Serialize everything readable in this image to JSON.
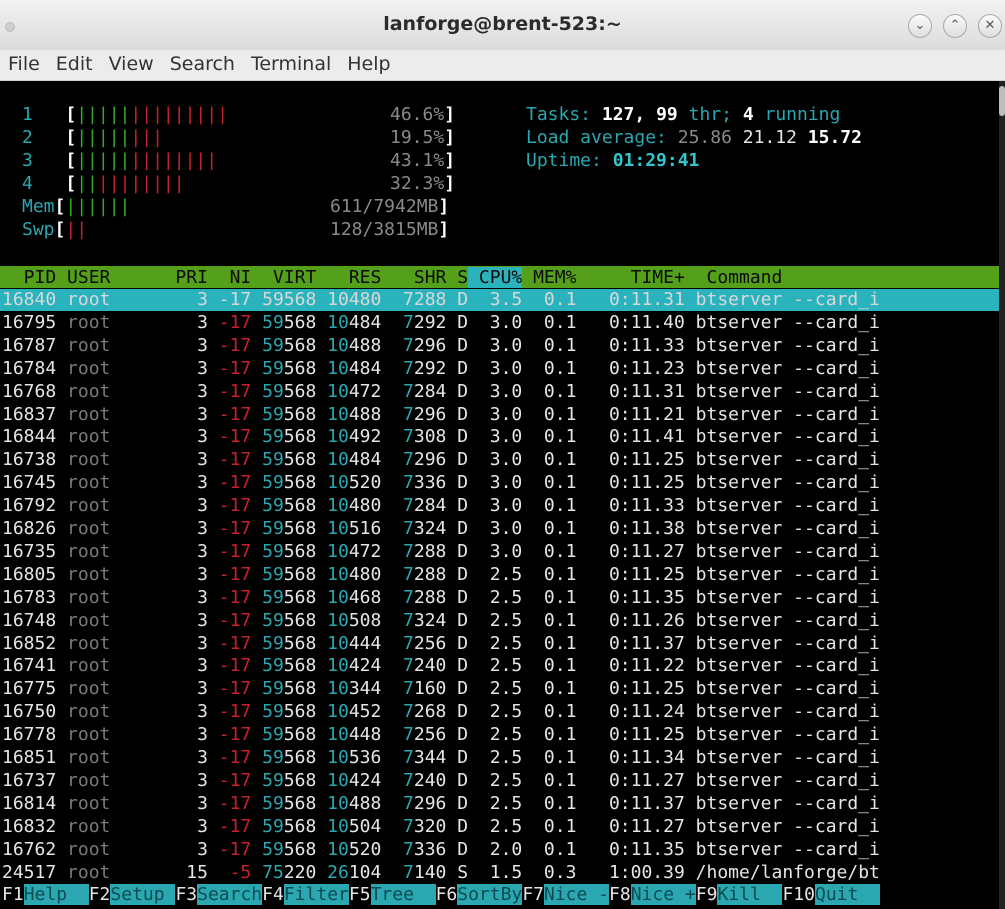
{
  "window": {
    "title": "lanforge@brent-523:~"
  },
  "menubar": [
    "File",
    "Edit",
    "View",
    "Search",
    "Terminal",
    "Help"
  ],
  "meters": {
    "cpu": [
      {
        "id": "1",
        "bar_green": "|||||",
        "bar_red": "|||||||||",
        "percent": "46.6%"
      },
      {
        "id": "2",
        "bar_green": "|||||",
        "bar_red": "|||",
        "percent": "19.5%"
      },
      {
        "id": "3",
        "bar_green": "|||||",
        "bar_red": "||||||||",
        "percent": "43.1%"
      },
      {
        "id": "4",
        "bar_green": "||",
        "bar_red": "||||||||",
        "percent": "32.3%"
      }
    ],
    "mem": {
      "label": "Mem",
      "bar_green": "||||||",
      "value": "611/7942MB"
    },
    "swp": {
      "label": "Swp",
      "bar_red": "||",
      "value": "128/3815MB"
    }
  },
  "summary": {
    "tasks_label": "Tasks:",
    "tasks": "127,",
    "threads": "99",
    "thr_label": "thr;",
    "running": "4",
    "running_label": "running",
    "load_label": "Load average:",
    "load1": "25.86",
    "load5": "21.12",
    "load15": "15.72",
    "uptime_label": "Uptime:",
    "uptime": "01:29:41"
  },
  "columns": [
    "PID",
    "USER",
    "PRI",
    "NI",
    "VIRT",
    "RES",
    "SHR",
    "S",
    "CPU%",
    "MEM%",
    "TIME+",
    "Command"
  ],
  "processes": [
    {
      "pid": "16840",
      "user": "root",
      "pri": "3",
      "ni": "-17",
      "virt": "59568",
      "res": "10480",
      "shr": "7288",
      "s": "D",
      "cpu": "3.5",
      "mem": "0.1",
      "time": "0:11.31",
      "cmd": "btserver --card_i"
    },
    {
      "pid": "16795",
      "user": "root",
      "pri": "3",
      "ni": "-17",
      "virt": "59568",
      "res": "10484",
      "shr": "7292",
      "s": "D",
      "cpu": "3.0",
      "mem": "0.1",
      "time": "0:11.40",
      "cmd": "btserver --card_i"
    },
    {
      "pid": "16787",
      "user": "root",
      "pri": "3",
      "ni": "-17",
      "virt": "59568",
      "res": "10488",
      "shr": "7296",
      "s": "D",
      "cpu": "3.0",
      "mem": "0.1",
      "time": "0:11.33",
      "cmd": "btserver --card_i"
    },
    {
      "pid": "16784",
      "user": "root",
      "pri": "3",
      "ni": "-17",
      "virt": "59568",
      "res": "10484",
      "shr": "7292",
      "s": "D",
      "cpu": "3.0",
      "mem": "0.1",
      "time": "0:11.23",
      "cmd": "btserver --card_i"
    },
    {
      "pid": "16768",
      "user": "root",
      "pri": "3",
      "ni": "-17",
      "virt": "59568",
      "res": "10472",
      "shr": "7284",
      "s": "D",
      "cpu": "3.0",
      "mem": "0.1",
      "time": "0:11.31",
      "cmd": "btserver --card_i"
    },
    {
      "pid": "16837",
      "user": "root",
      "pri": "3",
      "ni": "-17",
      "virt": "59568",
      "res": "10488",
      "shr": "7296",
      "s": "D",
      "cpu": "3.0",
      "mem": "0.1",
      "time": "0:11.21",
      "cmd": "btserver --card_i"
    },
    {
      "pid": "16844",
      "user": "root",
      "pri": "3",
      "ni": "-17",
      "virt": "59568",
      "res": "10492",
      "shr": "7308",
      "s": "D",
      "cpu": "3.0",
      "mem": "0.1",
      "time": "0:11.41",
      "cmd": "btserver --card_i"
    },
    {
      "pid": "16738",
      "user": "root",
      "pri": "3",
      "ni": "-17",
      "virt": "59568",
      "res": "10484",
      "shr": "7296",
      "s": "D",
      "cpu": "3.0",
      "mem": "0.1",
      "time": "0:11.25",
      "cmd": "btserver --card_i"
    },
    {
      "pid": "16745",
      "user": "root",
      "pri": "3",
      "ni": "-17",
      "virt": "59568",
      "res": "10520",
      "shr": "7336",
      "s": "D",
      "cpu": "3.0",
      "mem": "0.1",
      "time": "0:11.25",
      "cmd": "btserver --card_i"
    },
    {
      "pid": "16792",
      "user": "root",
      "pri": "3",
      "ni": "-17",
      "virt": "59568",
      "res": "10480",
      "shr": "7284",
      "s": "D",
      "cpu": "3.0",
      "mem": "0.1",
      "time": "0:11.33",
      "cmd": "btserver --card_i"
    },
    {
      "pid": "16826",
      "user": "root",
      "pri": "3",
      "ni": "-17",
      "virt": "59568",
      "res": "10516",
      "shr": "7324",
      "s": "D",
      "cpu": "3.0",
      "mem": "0.1",
      "time": "0:11.38",
      "cmd": "btserver --card_i"
    },
    {
      "pid": "16735",
      "user": "root",
      "pri": "3",
      "ni": "-17",
      "virt": "59568",
      "res": "10472",
      "shr": "7288",
      "s": "D",
      "cpu": "3.0",
      "mem": "0.1",
      "time": "0:11.27",
      "cmd": "btserver --card_i"
    },
    {
      "pid": "16805",
      "user": "root",
      "pri": "3",
      "ni": "-17",
      "virt": "59568",
      "res": "10480",
      "shr": "7288",
      "s": "D",
      "cpu": "2.5",
      "mem": "0.1",
      "time": "0:11.25",
      "cmd": "btserver --card_i"
    },
    {
      "pid": "16783",
      "user": "root",
      "pri": "3",
      "ni": "-17",
      "virt": "59568",
      "res": "10468",
      "shr": "7288",
      "s": "D",
      "cpu": "2.5",
      "mem": "0.1",
      "time": "0:11.35",
      "cmd": "btserver --card_i"
    },
    {
      "pid": "16748",
      "user": "root",
      "pri": "3",
      "ni": "-17",
      "virt": "59568",
      "res": "10508",
      "shr": "7324",
      "s": "D",
      "cpu": "2.5",
      "mem": "0.1",
      "time": "0:11.26",
      "cmd": "btserver --card_i"
    },
    {
      "pid": "16852",
      "user": "root",
      "pri": "3",
      "ni": "-17",
      "virt": "59568",
      "res": "10444",
      "shr": "7256",
      "s": "D",
      "cpu": "2.5",
      "mem": "0.1",
      "time": "0:11.37",
      "cmd": "btserver --card_i"
    },
    {
      "pid": "16741",
      "user": "root",
      "pri": "3",
      "ni": "-17",
      "virt": "59568",
      "res": "10424",
      "shr": "7240",
      "s": "D",
      "cpu": "2.5",
      "mem": "0.1",
      "time": "0:11.22",
      "cmd": "btserver --card_i"
    },
    {
      "pid": "16775",
      "user": "root",
      "pri": "3",
      "ni": "-17",
      "virt": "59568",
      "res": "10344",
      "shr": "7160",
      "s": "D",
      "cpu": "2.5",
      "mem": "0.1",
      "time": "0:11.25",
      "cmd": "btserver --card_i"
    },
    {
      "pid": "16750",
      "user": "root",
      "pri": "3",
      "ni": "-17",
      "virt": "59568",
      "res": "10452",
      "shr": "7268",
      "s": "D",
      "cpu": "2.5",
      "mem": "0.1",
      "time": "0:11.24",
      "cmd": "btserver --card_i"
    },
    {
      "pid": "16778",
      "user": "root",
      "pri": "3",
      "ni": "-17",
      "virt": "59568",
      "res": "10448",
      "shr": "7256",
      "s": "D",
      "cpu": "2.5",
      "mem": "0.1",
      "time": "0:11.25",
      "cmd": "btserver --card_i"
    },
    {
      "pid": "16851",
      "user": "root",
      "pri": "3",
      "ni": "-17",
      "virt": "59568",
      "res": "10536",
      "shr": "7344",
      "s": "D",
      "cpu": "2.5",
      "mem": "0.1",
      "time": "0:11.34",
      "cmd": "btserver --card_i"
    },
    {
      "pid": "16737",
      "user": "root",
      "pri": "3",
      "ni": "-17",
      "virt": "59568",
      "res": "10424",
      "shr": "7240",
      "s": "D",
      "cpu": "2.5",
      "mem": "0.1",
      "time": "0:11.27",
      "cmd": "btserver --card_i"
    },
    {
      "pid": "16814",
      "user": "root",
      "pri": "3",
      "ni": "-17",
      "virt": "59568",
      "res": "10488",
      "shr": "7296",
      "s": "D",
      "cpu": "2.5",
      "mem": "0.1",
      "time": "0:11.37",
      "cmd": "btserver --card_i"
    },
    {
      "pid": "16832",
      "user": "root",
      "pri": "3",
      "ni": "-17",
      "virt": "59568",
      "res": "10504",
      "shr": "7320",
      "s": "D",
      "cpu": "2.5",
      "mem": "0.1",
      "time": "0:11.27",
      "cmd": "btserver --card_i"
    },
    {
      "pid": "16762",
      "user": "root",
      "pri": "3",
      "ni": "-17",
      "virt": "59568",
      "res": "10520",
      "shr": "7336",
      "s": "D",
      "cpu": "2.0",
      "mem": "0.1",
      "time": "0:11.35",
      "cmd": "btserver --card_i"
    },
    {
      "pid": "24517",
      "user": "root",
      "pri": "15",
      "ni": "-5",
      "virt": "75220",
      "res": "26104",
      "shr": "7140",
      "s": "S",
      "cpu": "1.5",
      "mem": "0.3",
      "time": "1:00.39",
      "cmd": "/home/lanforge/bt"
    }
  ],
  "function_keys": [
    {
      "key": "F1",
      "label": "Help"
    },
    {
      "key": "F2",
      "label": "Setup"
    },
    {
      "key": "F3",
      "label": "Search"
    },
    {
      "key": "F4",
      "label": "Filter"
    },
    {
      "key": "F5",
      "label": "Tree"
    },
    {
      "key": "F6",
      "label": "SortBy"
    },
    {
      "key": "F7",
      "label": "Nice -"
    },
    {
      "key": "F8",
      "label": "Nice +"
    },
    {
      "key": "F9",
      "label": "Kill"
    },
    {
      "key": "F10",
      "label": "Quit"
    }
  ],
  "colors": {
    "header_bg": "#55a01a",
    "selected_bg": "#2ab3bd",
    "ni_negative": "#c8202a"
  }
}
